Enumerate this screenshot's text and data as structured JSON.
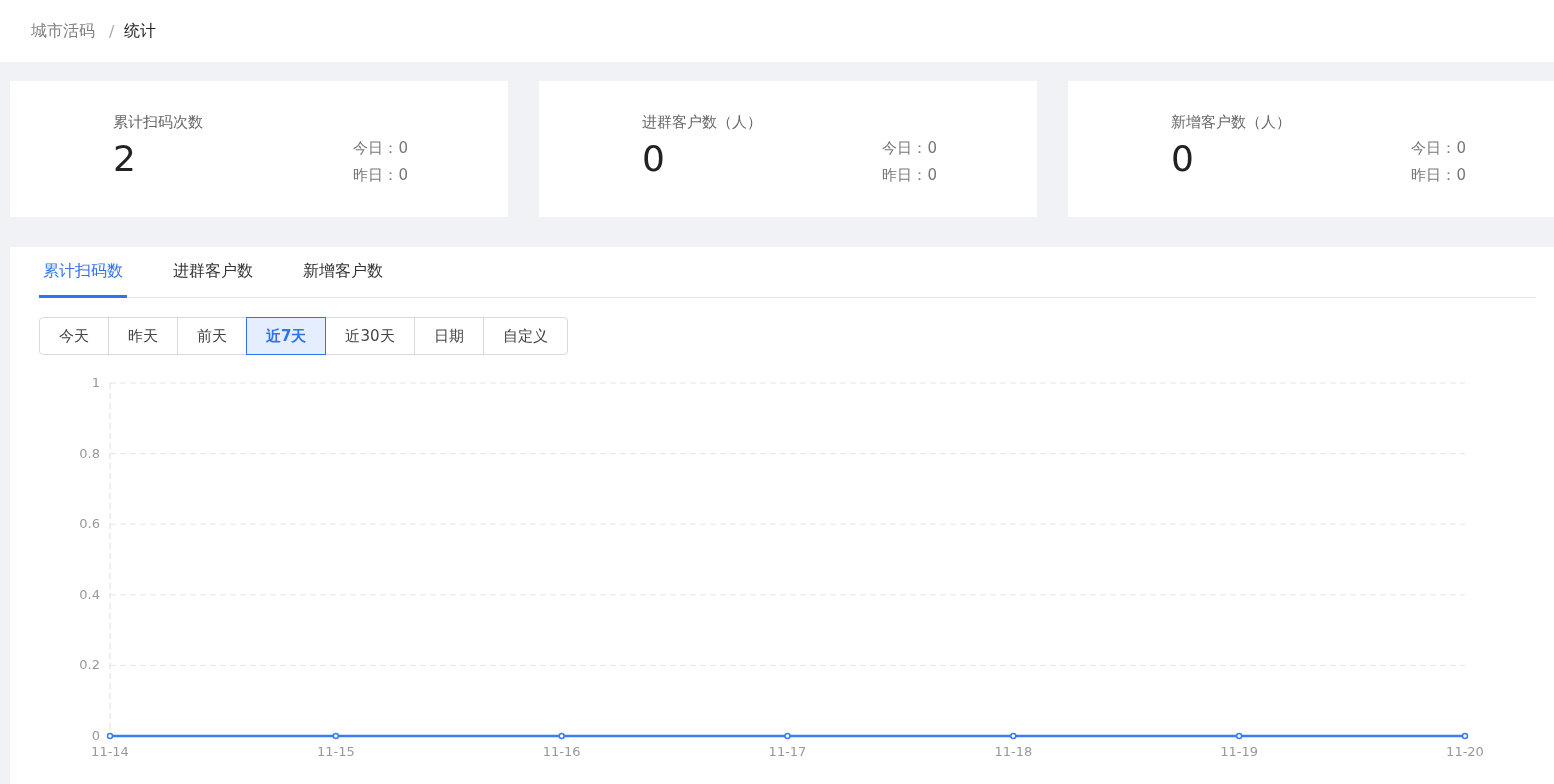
{
  "breadcrumb": [
    {
      "label": "城市活码",
      "current": false
    },
    {
      "label": "统计",
      "current": true
    }
  ],
  "breadcrumb_separator": "/",
  "stat_cards": [
    {
      "title": "累计扫码次数",
      "value": "2",
      "today": "今日：0",
      "yesterday": "昨日：0"
    },
    {
      "title": "进群客户数（人）",
      "value": "0",
      "today": "今日：0",
      "yesterday": "昨日：0"
    },
    {
      "title": "新增客户数（人）",
      "value": "0",
      "today": "今日：0",
      "yesterday": "昨日：0"
    }
  ],
  "tabs": [
    {
      "label": "累计扫码数",
      "selected": true
    },
    {
      "label": "进群客户数",
      "selected": false
    },
    {
      "label": "新增客户数",
      "selected": false
    }
  ],
  "ranges": [
    {
      "label": "今天",
      "selected": false
    },
    {
      "label": "昨天",
      "selected": false
    },
    {
      "label": "前天",
      "selected": false
    },
    {
      "label": "近7天",
      "selected": true
    },
    {
      "label": "近30天",
      "selected": false
    },
    {
      "label": "日期",
      "selected": false
    },
    {
      "label": "自定义",
      "selected": false
    }
  ],
  "chart": {
    "chart_data": {
      "type": "line",
      "categories": [
        "11-14",
        "11-15",
        "11-16",
        "11-17",
        "11-18",
        "11-19",
        "11-20"
      ],
      "series": [
        {
          "color": "#3a7cf2",
          "marker": true,
          "values": [
            0,
            0,
            0,
            0,
            0,
            0,
            0
          ]
        }
      ],
      "grid": true,
      "ylim": [
        0,
        1
      ],
      "yticks": [
        0,
        0.2,
        0.4,
        0.6,
        0.8,
        1
      ]
    }
  }
}
